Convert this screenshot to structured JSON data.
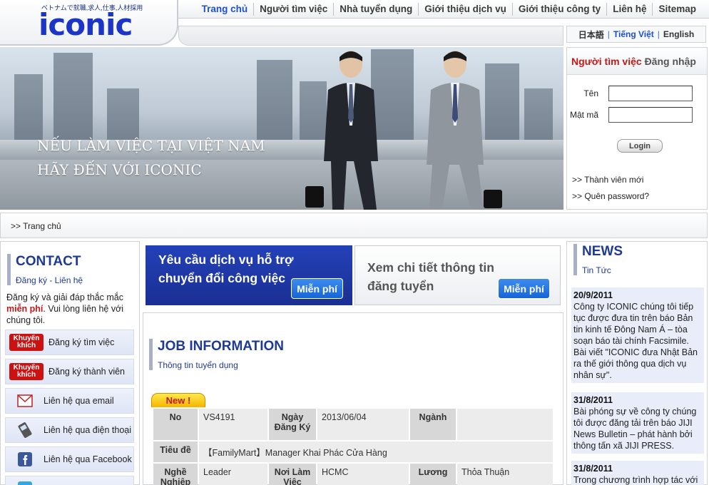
{
  "header": {
    "logo_tagline": "ベトナムで就職,求人,仕事,人材採用",
    "logo_text": "iconic",
    "nav": [
      "Trang chủ",
      "Người tìm việc",
      "Nhà tuyển dụng",
      "Giới thiệu dịch vụ",
      "Giới thiệu công ty",
      "Liên hệ",
      "Sitemap"
    ],
    "languages": [
      "日本語",
      "Tiếng Việt",
      "English"
    ]
  },
  "banner": {
    "line1": "NẾU LÀM VIỆC TẠI VIỆT NAM",
    "line2": "HÃY ĐẾN VỚI ICONIC"
  },
  "login": {
    "title_part1": "Người tìm việc",
    "title_part2": "Đăng nhập",
    "name_label": "Tên",
    "password_label": "Mật mã",
    "button": "Login",
    "new_member": ">> Thành viên mới",
    "forgot_password": ">> Quên password?"
  },
  "breadcrumb": ">> Trang chủ",
  "contact": {
    "title": "CONTACT",
    "subtitle": "Đăng ký - Liên hệ",
    "desc_part1": "Đăng ký và giải đáp thắc mắc ",
    "desc_highlight": "miễn phí",
    "desc_part2": ". Vui lòng liên hệ với chúng tôi.",
    "badge_line1": "Khuyến",
    "badge_line2": "khích",
    "items": [
      "Đăng ký tìm việc",
      "Đăng ký thành viên",
      "Liên hệ qua email",
      "Liên hệ qua điện thoại",
      "Liên hệ qua Facebook"
    ]
  },
  "promos": [
    {
      "text": "Yêu cầu dịch vụ hỗ trợ chuyển đổi công việc",
      "button": "Miễn phí"
    },
    {
      "text": "Xem chi tiết thông tin đăng tuyển",
      "button": "Miễn phí"
    }
  ],
  "jobs": {
    "title": "JOB INFORMATION",
    "subtitle": "Thông tin tuyển dụng",
    "new_tag": "New !",
    "labels": {
      "no": "No",
      "date": "Ngày Đăng Ký",
      "industry": "Ngành",
      "job_title": "Tiêu đề",
      "profession": "Nghề Nghiệp",
      "location": "Nơi Làm Việc",
      "salary": "Lương"
    },
    "values": {
      "no": "VS4191",
      "date": "2013/06/04",
      "industry": "",
      "job_title": "【FamilyMart】Manager Khai Phác Cửa Hàng",
      "profession": "Leader",
      "location": "HCMC",
      "salary": "Thỏa Thuận"
    }
  },
  "news": {
    "title": "NEWS",
    "subtitle": "Tin Tức",
    "items": [
      {
        "date": "20/9/2011",
        "text": "Công ty ICONIC chúng tôi tiếp tục được đưa tin trên báo Bản tin kinh tế Đông Nam Á – tòa soạn báo tài chính Facsimile. Bài viết \"ICONIC đưa Nhật Bản ra thế giới thông qua dịch vụ nhân sự\"."
      },
      {
        "date": "31/8/2011",
        "text": "Bài phóng sự về công ty chúng tôi được đăng tải trên báo JIJI News Bulletin – phát hành bởi thông tấn xã JIJI PRESS."
      },
      {
        "date": "31/8/2011",
        "text": "Trong chương trình hợp tác với"
      }
    ]
  }
}
